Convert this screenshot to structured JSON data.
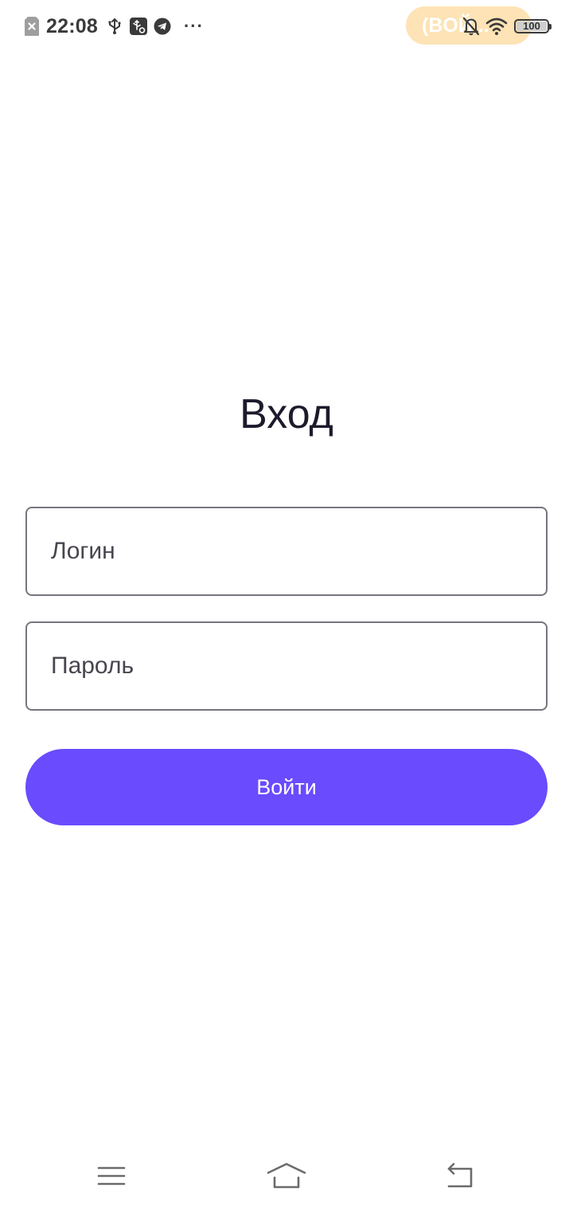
{
  "status_bar": {
    "time": "22:08",
    "pill_text": "(BOЙ...",
    "battery_level": "100",
    "icons": [
      "sim-error-icon",
      "usb-icon",
      "usb-debug-icon",
      "telegram-icon",
      "more-icon",
      "bell-off-icon",
      "wifi-icon",
      "battery-icon"
    ],
    "more_label": "···"
  },
  "login": {
    "title": "Вход",
    "login_placeholder": "Логин",
    "password_placeholder": "Пароль",
    "submit_label": "Войти"
  },
  "colors": {
    "accent": "#6a4bfd",
    "field_border": "#79747e",
    "pill": "#fde3b5",
    "text": "#1c1b2b"
  },
  "nav_bar": {
    "icons": [
      "menu-icon",
      "home-icon",
      "back-icon"
    ]
  }
}
